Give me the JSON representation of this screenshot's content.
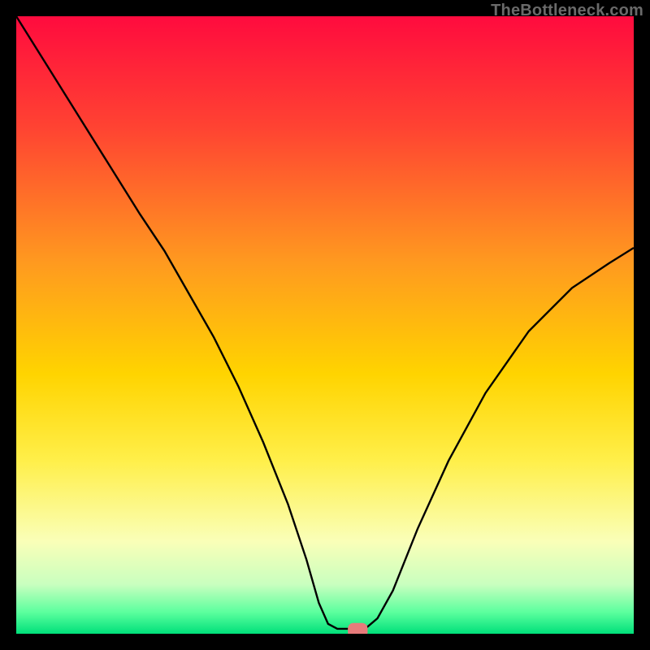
{
  "watermark": "TheBottleneck.com",
  "chart_data": {
    "type": "line",
    "title": "",
    "xlabel": "",
    "ylabel": "",
    "xlim": [
      0,
      100
    ],
    "ylim": [
      0,
      100
    ],
    "grid": false,
    "legend": false,
    "background_gradient_stops": [
      {
        "offset": 0.0,
        "color": "#ff0b3e"
      },
      {
        "offset": 0.18,
        "color": "#ff4332"
      },
      {
        "offset": 0.4,
        "color": "#ff9a1f"
      },
      {
        "offset": 0.58,
        "color": "#ffd400"
      },
      {
        "offset": 0.72,
        "color": "#ffef4a"
      },
      {
        "offset": 0.85,
        "color": "#faffb8"
      },
      {
        "offset": 0.92,
        "color": "#c9ffbf"
      },
      {
        "offset": 0.965,
        "color": "#5cff9e"
      },
      {
        "offset": 1.0,
        "color": "#00e07a"
      }
    ],
    "curve": {
      "name": "bottleneck-curve",
      "stroke": "#000000",
      "stroke_width": 2.4,
      "x": [
        0,
        5,
        10,
        15,
        20,
        24,
        28,
        32,
        36,
        40,
        44,
        47,
        49,
        50.5,
        52,
        55,
        56.5,
        58.5,
        61,
        65,
        70,
        76,
        83,
        90,
        96,
        100
      ],
      "y": [
        100,
        92,
        84,
        76,
        68,
        62,
        55,
        48,
        40,
        31,
        21,
        12,
        5,
        1.6,
        0.8,
        0.8,
        0.8,
        2.5,
        7,
        17,
        28,
        39,
        49,
        56,
        60,
        62.5
      ]
    },
    "marker": {
      "name": "optimum-marker",
      "shape": "rounded-rect",
      "cx": 55.3,
      "cy": 0.55,
      "width": 3.2,
      "height": 2.4,
      "color": "#e77b7b"
    }
  }
}
